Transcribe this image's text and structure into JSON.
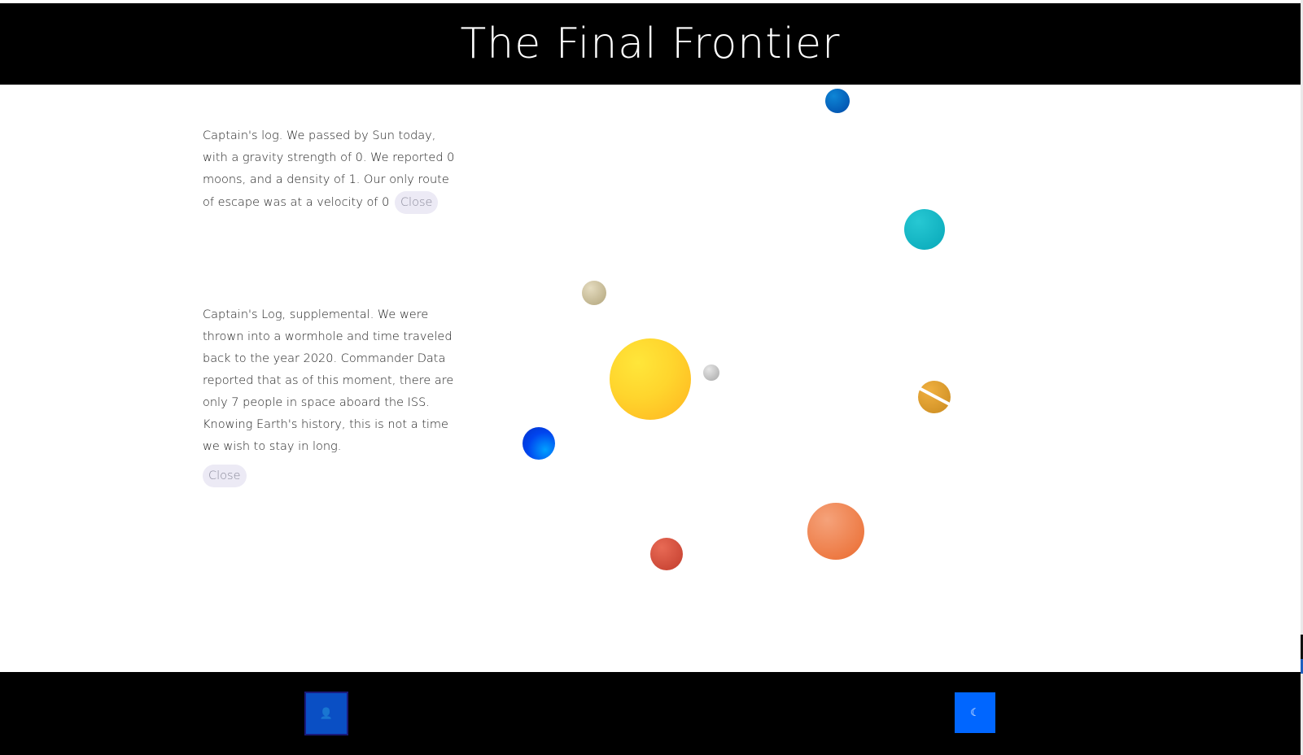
{
  "header": {
    "title": "The Final Frontier"
  },
  "logs": [
    {
      "text": "Captain's log. We passed by Sun today, with a gravity strength of 0. We reported 0 moons, and a density of 1. Our only route of escape was at a velocity of 0",
      "close_label": "Close"
    },
    {
      "text": "Captain's Log, supplemental. We were thrown into a wormhole and time traveled back to the year 2020. Commander Data reported that as of this moment, there are only 7 people in space aboard the ISS. Knowing Earth's history, this is not a time we wish to stay in long.",
      "close_label": "Close"
    }
  ],
  "planets": [
    {
      "name": "sun",
      "color": "#ffd52d"
    },
    {
      "name": "mercury",
      "color": "#a7a7a7"
    },
    {
      "name": "venus",
      "color": "#b1a47b"
    },
    {
      "name": "earth",
      "color": "#0044ee"
    },
    {
      "name": "mars",
      "color": "#c23c2c"
    },
    {
      "name": "jupiter",
      "color": "#ea6a2e"
    },
    {
      "name": "saturn",
      "color": "#c98a1f"
    },
    {
      "name": "uranus",
      "color": "#07a7b8"
    },
    {
      "name": "neptune",
      "color": "#0049a8"
    }
  ],
  "footer": {
    "profile_icon": "astronaut-icon",
    "profile_glyph": "👤",
    "theme_icon": "moon-icon",
    "theme_glyph": "☾"
  },
  "colors": {
    "header_bg": "#000000",
    "footer_bg": "#000000",
    "button_blue": "#0066ff",
    "close_bg": "#eceaf5"
  }
}
